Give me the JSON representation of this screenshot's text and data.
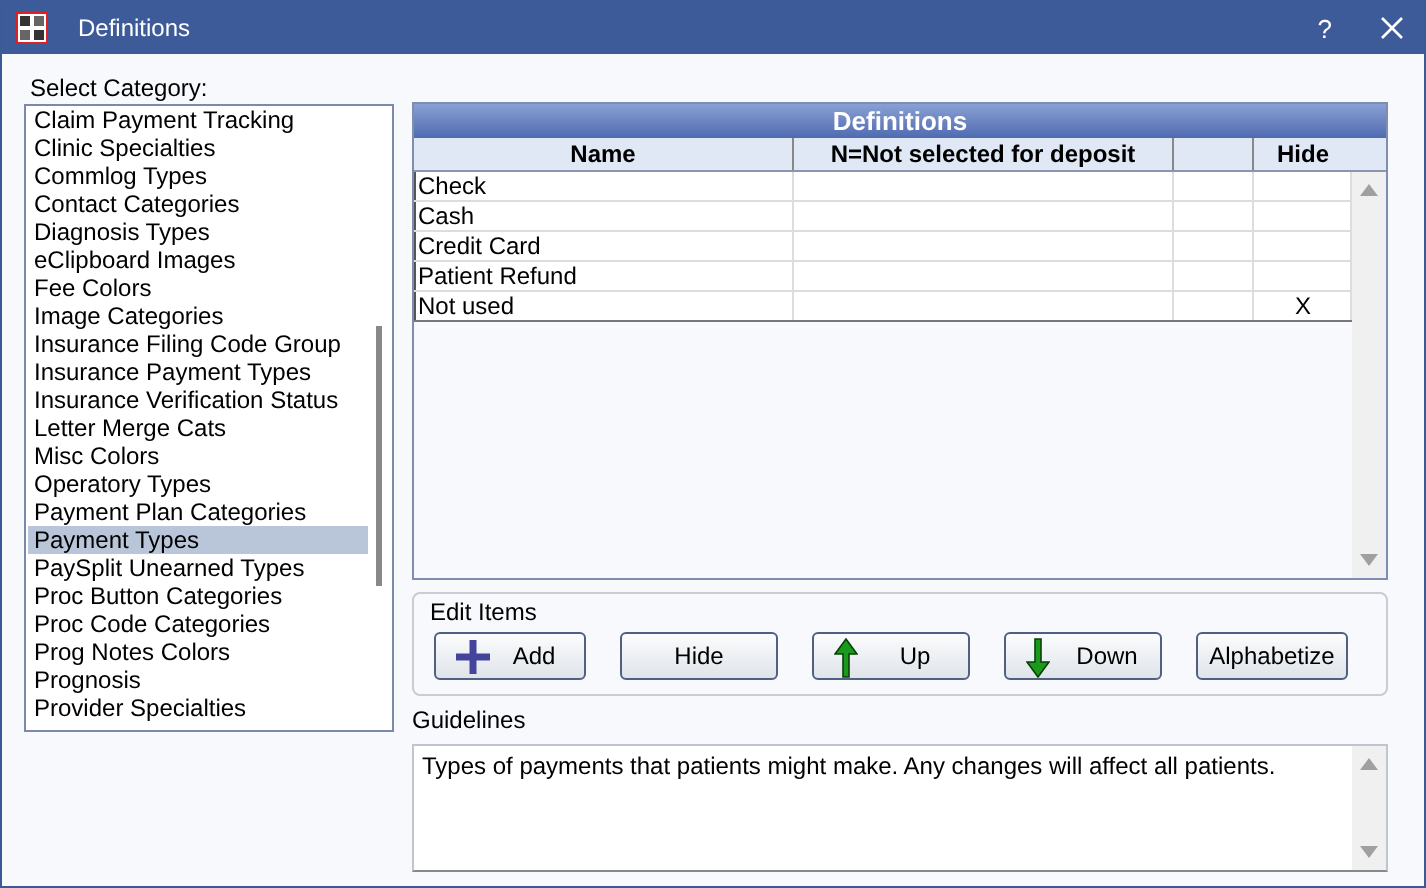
{
  "window": {
    "title": "Definitions",
    "buttons": [
      {
        "kind": "help",
        "label": "?"
      }
    ]
  },
  "category_label": "Select Category:",
  "categories": [
    {
      "label": "Claim Payment Tracking",
      "selected": false
    },
    {
      "label": "Clinic Specialties",
      "selected": false
    },
    {
      "label": "Commlog Types",
      "selected": false
    },
    {
      "label": "Contact Categories",
      "selected": false
    },
    {
      "label": "Diagnosis Types",
      "selected": false
    },
    {
      "label": "eClipboard Images",
      "selected": false
    },
    {
      "label": "Fee Colors",
      "selected": false
    },
    {
      "label": "Image Categories",
      "selected": false
    },
    {
      "label": "Insurance Filing Code Group",
      "selected": false
    },
    {
      "label": "Insurance Payment Types",
      "selected": false
    },
    {
      "label": "Insurance Verification Status",
      "selected": false
    },
    {
      "label": "Letter Merge Cats",
      "selected": false
    },
    {
      "label": "Misc Colors",
      "selected": false
    },
    {
      "label": "Operatory Types",
      "selected": false
    },
    {
      "label": "Payment Plan Categories",
      "selected": false
    },
    {
      "label": "Payment Types",
      "selected": true
    },
    {
      "label": "PaySplit Unearned Types",
      "selected": false
    },
    {
      "label": "Proc Button Categories",
      "selected": false
    },
    {
      "label": "Proc Code Categories",
      "selected": false
    },
    {
      "label": "Prog Notes Colors",
      "selected": false
    },
    {
      "label": "Prognosis",
      "selected": false
    },
    {
      "label": "Provider Specialties",
      "selected": false
    }
  ],
  "grid": {
    "title": "Definitions",
    "columns": [
      "Name",
      "N=Not selected for deposit",
      "",
      "Hide"
    ],
    "rows": [
      {
        "name": "Check"
      },
      {
        "name": "Cash"
      },
      {
        "name": "Credit Card"
      },
      {
        "name": "Patient Refund"
      },
      {
        "name": "Not used",
        "hide": "X"
      }
    ]
  },
  "edit_items": {
    "title": "Edit Items",
    "buttons": [
      {
        "kind": "add",
        "label": "Add"
      },
      {
        "kind": "plain",
        "label": "Hide"
      },
      {
        "kind": "up",
        "label": "Up"
      },
      {
        "kind": "down",
        "label": "Down"
      },
      {
        "kind": "plain",
        "label": "Alphabetize"
      }
    ]
  },
  "guidelines": {
    "label": "Guidelines",
    "text": "Types of payments that patients might make. Any changes will affect all patients."
  }
}
